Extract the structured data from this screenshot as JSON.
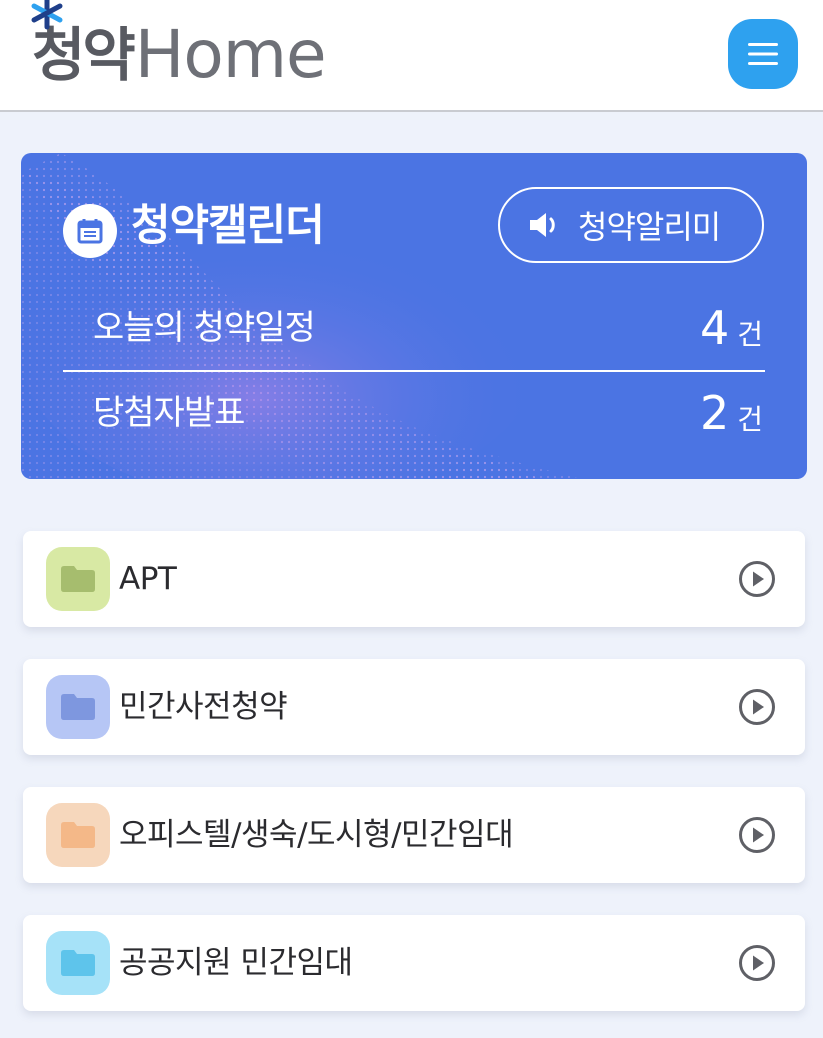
{
  "header": {
    "logo_korean": "청약",
    "logo_english": "Home",
    "logo_colors": {
      "korean": "#585a61",
      "english": "#6e7077",
      "star_dark": "#1f3f8a",
      "star_light": "#2ea1ef"
    },
    "menu_icon": "hamburger-icon",
    "menu_color": "#2ea1ef"
  },
  "calendar": {
    "title": "청약캘린더",
    "icon": "calendar-icon",
    "background": "#4b74e3",
    "alarm_button": {
      "label": "청약알리미",
      "icon": "speaker-icon"
    },
    "rows": [
      {
        "label": "오늘의 청약일정",
        "count": "4",
        "unit": "건"
      },
      {
        "label": "당첨자발표",
        "count": "2",
        "unit": "건"
      }
    ]
  },
  "categories": [
    {
      "label": "APT",
      "icon": "folder-icon",
      "icon_bg": "#d8e9a4",
      "icon_color": "#a6bd6e"
    },
    {
      "label": "민간사전청약",
      "icon": "folder-icon",
      "icon_bg": "#b6c6f5",
      "icon_color": "#7e97df"
    },
    {
      "label": "오피스텔/생숙/도시형/민간임대",
      "icon": "folder-icon",
      "icon_bg": "#f6d7bc",
      "icon_color": "#f4b888"
    },
    {
      "label": "공공지원 민간임대",
      "icon": "folder-icon",
      "icon_bg": "#a6e2f8",
      "icon_color": "#5ec4eb"
    }
  ],
  "arrow_icon": "play-circle-icon"
}
